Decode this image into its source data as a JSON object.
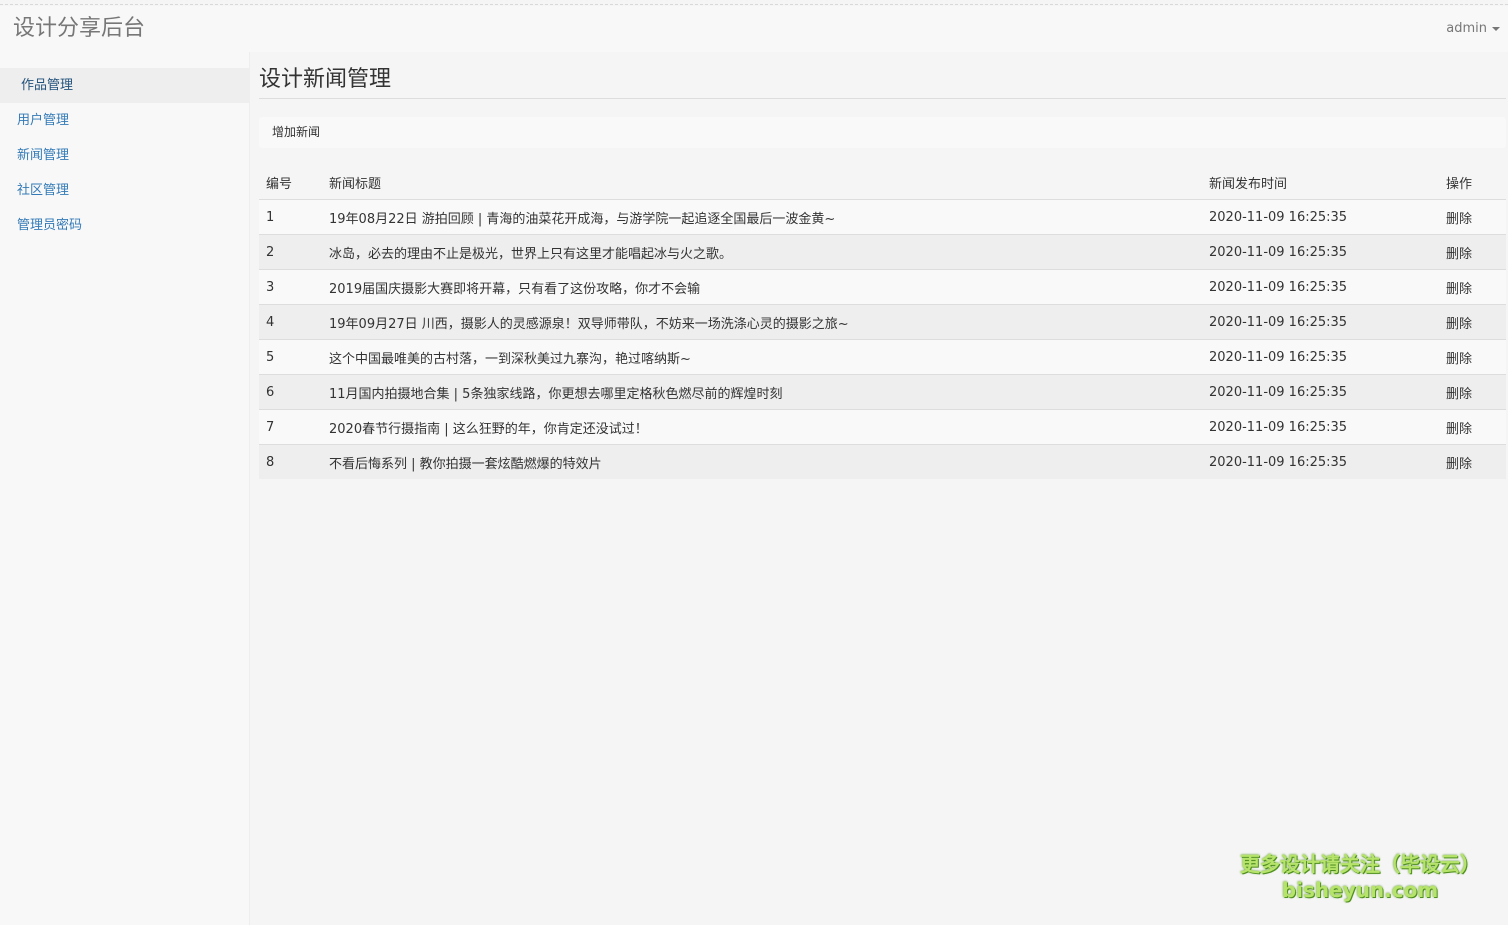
{
  "header": {
    "brand": "设计分享后台",
    "user": "admin"
  },
  "sidebar": {
    "items": [
      {
        "label": "作品管理"
      },
      {
        "label": "用户管理"
      },
      {
        "label": "新闻管理"
      },
      {
        "label": "社区管理"
      },
      {
        "label": "管理员密码"
      }
    ],
    "active_index": 0
  },
  "main": {
    "title": "设计新闻管理",
    "add_label": "增加新闻",
    "table": {
      "columns": [
        "编号",
        "新闻标题",
        "新闻发布时间",
        "操作"
      ],
      "rows": [
        {
          "id": "1",
          "title": "19年08月22日 游拍回顾 | 青海的油菜花开成海，与游学院一起追逐全国最后一波金黄~",
          "time": "2020-11-09 16:25:35",
          "action": "删除"
        },
        {
          "id": "2",
          "title": "冰岛，必去的理由不止是极光，世界上只有这里才能唱起冰与火之歌。",
          "time": "2020-11-09 16:25:35",
          "action": "删除"
        },
        {
          "id": "3",
          "title": "2019届国庆摄影大赛即将开幕，只有看了这份攻略，你才不会输",
          "time": "2020-11-09 16:25:35",
          "action": "删除"
        },
        {
          "id": "4",
          "title": "19年09月27日 川西，摄影人的灵感源泉！双导师带队，不妨来一场洗涤心灵的摄影之旅~",
          "time": "2020-11-09 16:25:35",
          "action": "删除"
        },
        {
          "id": "5",
          "title": "这个中国最唯美的古村落，一到深秋美过九寨沟，艳过喀纳斯~",
          "time": "2020-11-09 16:25:35",
          "action": "删除"
        },
        {
          "id": "6",
          "title": "11月国内拍摄地合集 | 5条独家线路，你更想去哪里定格秋色燃尽前的辉煌时刻",
          "time": "2020-11-09 16:25:35",
          "action": "删除"
        },
        {
          "id": "7",
          "title": "2020春节行摄指南 | 这么狂野的年，你肯定还没试过！",
          "time": "2020-11-09 16:25:35",
          "action": "删除"
        },
        {
          "id": "8",
          "title": "不看后悔系列 | 教你拍摄一套炫酷燃爆的特效片",
          "time": "2020-11-09 16:25:35",
          "action": "删除"
        }
      ]
    }
  },
  "watermark": {
    "line1": "更多设计请关注（毕设云）",
    "line2": "bisheyun.com"
  },
  "colors": {
    "link": "#337ab7",
    "watermark_fill": "#b6e36a",
    "watermark_outline": "#4f8f1f"
  }
}
